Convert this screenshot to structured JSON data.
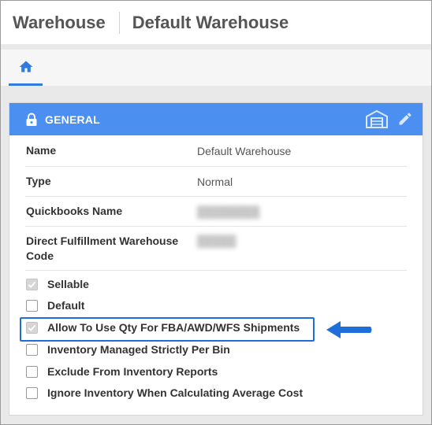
{
  "header": {
    "app_title": "Warehouse",
    "record_title": "Default Warehouse"
  },
  "tabs": [
    {
      "icon": "home-icon",
      "active": true
    }
  ],
  "card": {
    "title": "GENERAL",
    "icons": [
      "lock-icon",
      "warehouse-icon",
      "edit-pencil-icon"
    ],
    "accent_color": "#4b8ff0"
  },
  "fields": [
    {
      "label": "Name",
      "value": "Default Warehouse",
      "redacted": false
    },
    {
      "label": "Type",
      "value": "Normal",
      "redacted": false
    },
    {
      "label": "Quickbooks Name",
      "value": "",
      "redacted": true
    },
    {
      "label": "Direct Fulfillment Warehouse Code",
      "value": "",
      "redacted": true
    }
  ],
  "checkboxes": [
    {
      "label": "Sellable",
      "checked": true,
      "disabled": true
    },
    {
      "label": "Default",
      "checked": false,
      "disabled": false
    },
    {
      "label": "Allow To Use Qty For FBA/AWD/WFS Shipments",
      "checked": true,
      "disabled": true,
      "highlighted": true
    },
    {
      "label": "Inventory Managed Strictly Per Bin",
      "checked": false,
      "disabled": false
    },
    {
      "label": "Exclude From Inventory Reports",
      "checked": false,
      "disabled": false
    },
    {
      "label": "Ignore Inventory When Calculating Average Cost",
      "checked": false,
      "disabled": false
    }
  ],
  "annotation": {
    "highlight_color": "#1e6fd9",
    "arrow_color": "#1e6fd9"
  }
}
